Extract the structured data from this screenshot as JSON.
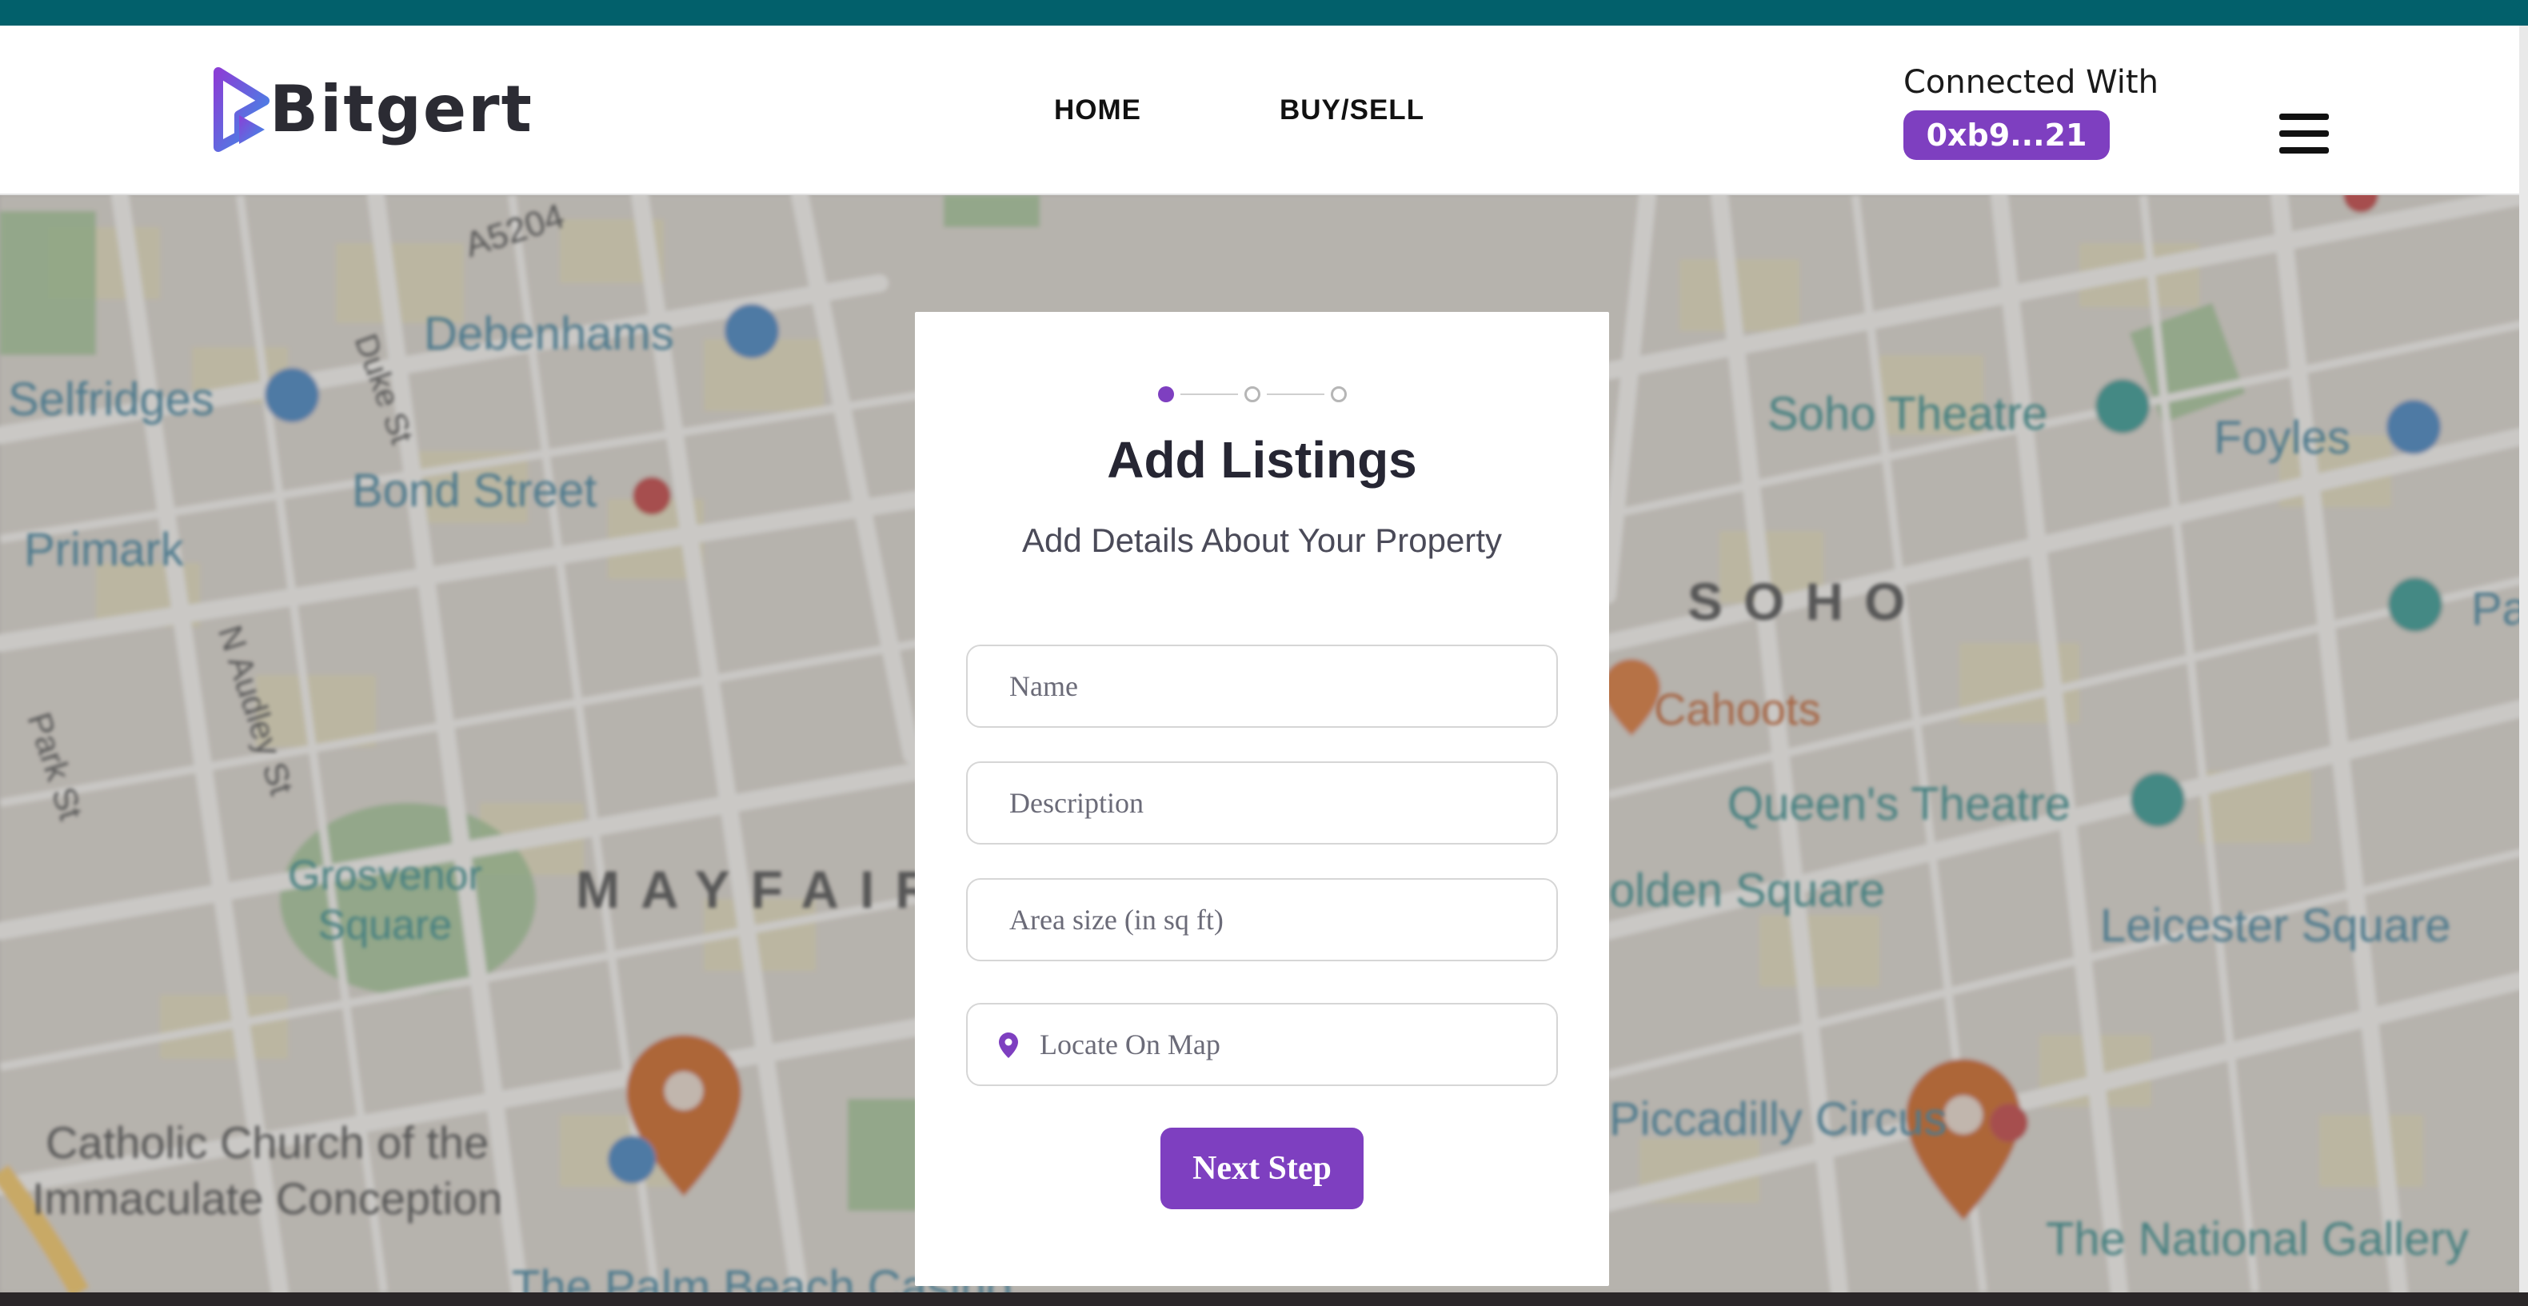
{
  "brand": {
    "name": "Bitgert",
    "logo_icon": "bitgert-logo-icon"
  },
  "nav": {
    "links": [
      {
        "label": "HOME"
      },
      {
        "label": "BUY/SELL"
      }
    ]
  },
  "wallet": {
    "connected_label": "Connected With",
    "address": "0xb9...21"
  },
  "menu": {
    "icon": "hamburger-menu-icon"
  },
  "map_labels": {
    "selfridges": "Selfridges",
    "debenhams": "Debenhams",
    "bond_street": "Bond Street",
    "primark": "Primark",
    "a5204": "A5204",
    "duke_st": "Duke St",
    "n_audley_st": "N Audley St",
    "park_st": "Park St",
    "grosvenor_square": "Grosvenor\nSquare",
    "mayfair": "MAYFAIR",
    "catholic_church": "Catholic Church of the\nImmaculate Conception",
    "palm_beach": "The Palm Beach Casino",
    "soho_theatre": "Soho Theatre",
    "foyles": "Foyles",
    "soho": "SOHO",
    "cahoots": "Cahoots",
    "queens_theatre": "Queen's Theatre",
    "golden_square": "olden Square",
    "leicester_square": "Leicester Square",
    "piccadilly_circus": "Piccadilly Circus",
    "national_gallery": "The National Gallery",
    "pa": "Pa"
  },
  "form": {
    "steps": {
      "total": 3,
      "current": 1
    },
    "title": "Add Listings",
    "subtitle": "Add Details About Your Property",
    "fields": {
      "name": {
        "placeholder": "Name",
        "value": ""
      },
      "description": {
        "placeholder": "Description",
        "value": ""
      },
      "area": {
        "placeholder": "Area size (in sq ft)",
        "value": ""
      },
      "location": {
        "placeholder": "Locate On Map",
        "value": "",
        "icon": "map-pin-icon"
      }
    },
    "next_button": "Next Step"
  },
  "colors": {
    "accent": "#7e3fc0",
    "top_strip": "#02606b",
    "map_pin_orange": "#cc6a2c",
    "map_pin_blue": "#4a86bf",
    "map_pin_teal": "#3a9a94"
  }
}
